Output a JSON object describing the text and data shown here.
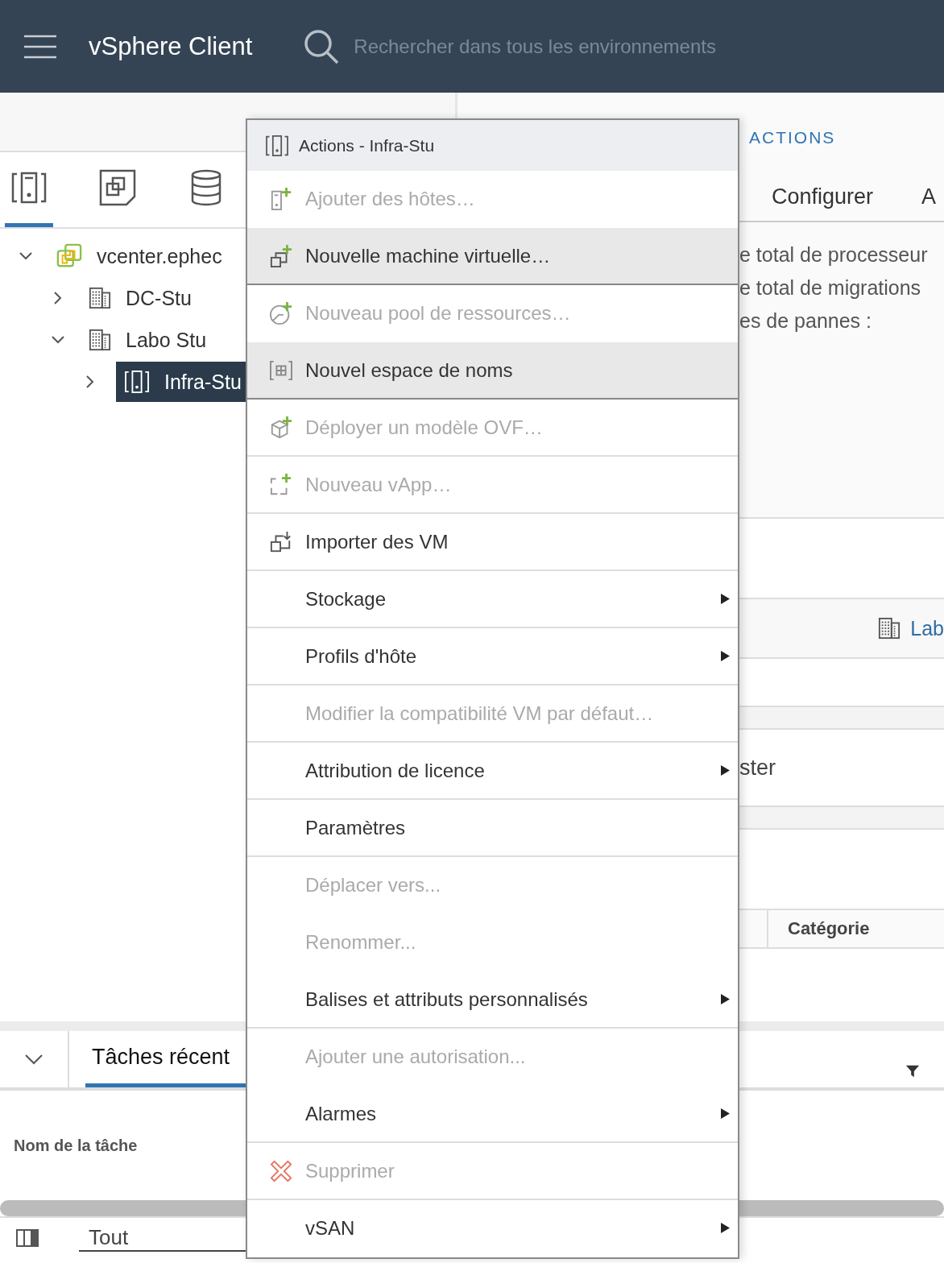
{
  "header": {
    "title": "vSphere Client",
    "search": {
      "placeholder": "Rechercher dans tous les environnements"
    }
  },
  "navigator": {
    "tabs": [
      {
        "selected": true
      },
      {
        "selected": false
      },
      {
        "selected": false
      }
    ],
    "tree": [
      {
        "label": "vcenter.ephec",
        "expanded": true,
        "selected": false,
        "children": [
          {
            "label": "DC-Stu",
            "expanded": false,
            "selected": false
          },
          {
            "label": "Labo Stu",
            "expanded": true,
            "selected": false,
            "children": [
              {
                "label": "Infra-Stu",
                "expanded": false,
                "selected": true
              }
            ]
          }
        ]
      }
    ]
  },
  "content": {
    "actions_label": "ACTIONS",
    "tabs": [
      {
        "label": "Configurer",
        "selected": false
      },
      {
        "label": "A",
        "selected": false
      }
    ],
    "summary_lines": [
      "e total de processeur",
      "e total de migrations",
      "es de pannes :"
    ],
    "link": "Lab",
    "cluster_text": "ster",
    "table_column": "Catégorie"
  },
  "context_menu": {
    "title": "Actions - Infra-Stu",
    "items": [
      {
        "label": "Ajouter des hôtes…",
        "kind": "icon",
        "disabled": true,
        "highlighted": false,
        "submenu": false,
        "separator": false
      },
      {
        "label": "Nouvelle machine virtuelle…",
        "kind": "icon",
        "disabled": false,
        "highlighted": true,
        "submenu": false,
        "separator": true
      },
      {
        "label": "Nouveau pool de ressources…",
        "kind": "icon",
        "disabled": true,
        "highlighted": false,
        "submenu": false,
        "separator": false
      },
      {
        "label": "Nouvel espace de noms",
        "kind": "icon",
        "disabled": false,
        "highlighted": true,
        "submenu": false,
        "separator": true
      },
      {
        "label": "Déployer un modèle OVF…",
        "kind": "icon",
        "disabled": true,
        "highlighted": false,
        "submenu": false,
        "separator": true
      },
      {
        "label": "Nouveau vApp…",
        "kind": "icon",
        "disabled": true,
        "highlighted": false,
        "submenu": false,
        "separator": true
      },
      {
        "label": "Importer des VM",
        "kind": "icon",
        "disabled": false,
        "highlighted": false,
        "submenu": false,
        "separator": true
      },
      {
        "label": "Stockage",
        "kind": "text",
        "disabled": false,
        "highlighted": false,
        "submenu": true,
        "separator": true
      },
      {
        "label": "Profils d'hôte",
        "kind": "text",
        "disabled": false,
        "highlighted": false,
        "submenu": true,
        "separator": true
      },
      {
        "label": "Modifier la compatibilité VM par défaut…",
        "kind": "text",
        "disabled": true,
        "highlighted": false,
        "submenu": false,
        "separator": true
      },
      {
        "label": "Attribution de licence",
        "kind": "text",
        "disabled": false,
        "highlighted": false,
        "submenu": true,
        "separator": true
      },
      {
        "label": "Paramètres",
        "kind": "text",
        "disabled": false,
        "highlighted": false,
        "submenu": false,
        "separator": true
      },
      {
        "label": "Déplacer vers...",
        "kind": "text",
        "disabled": true,
        "highlighted": false,
        "submenu": false,
        "separator": false
      },
      {
        "label": "Renommer...",
        "kind": "text",
        "disabled": true,
        "highlighted": false,
        "submenu": false,
        "separator": false
      },
      {
        "label": "Balises et attributs personnalisés",
        "kind": "text",
        "disabled": false,
        "highlighted": false,
        "submenu": true,
        "separator": true
      },
      {
        "label": "Ajouter une autorisation...",
        "kind": "text",
        "disabled": true,
        "highlighted": false,
        "submenu": false,
        "separator": false
      },
      {
        "label": "Alarmes",
        "kind": "text",
        "disabled": false,
        "highlighted": false,
        "submenu": true,
        "separator": true
      },
      {
        "label": "Supprimer",
        "kind": "icon",
        "disabled": true,
        "highlighted": false,
        "submenu": false,
        "separator": true
      },
      {
        "label": "vSAN",
        "kind": "text",
        "disabled": false,
        "highlighted": false,
        "submenu": true,
        "separator": false
      }
    ]
  },
  "tasks": {
    "tab": {
      "label": "Tâches récent",
      "selected": true
    },
    "column": "Nom de la tâche",
    "filter": "Tout"
  }
}
